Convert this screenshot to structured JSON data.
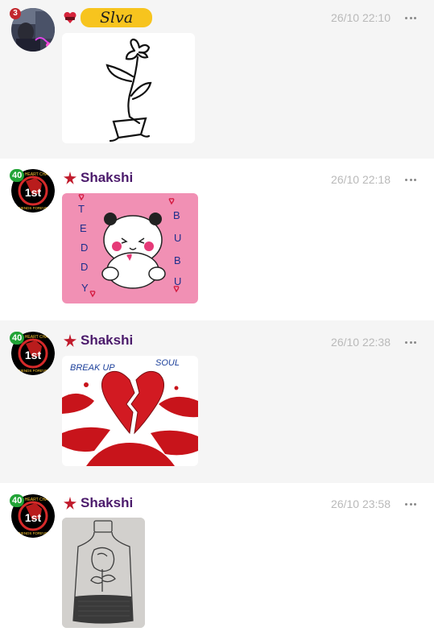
{
  "feed": {
    "posts": [
      {
        "author": "Slva",
        "level": "3",
        "timestamp": "26/10 22:10",
        "image": "flower-pot-drawing"
      },
      {
        "author": "Shakshi",
        "level": "40",
        "avatar_text_top": "TAH HEART CHAT",
        "avatar_text_mid": "1st",
        "avatar_text_bottom": "FRIENDS FOREVER",
        "timestamp": "26/10 22:18",
        "image": "teddy-bubu-drawing",
        "image_text_left": [
          "T",
          "E",
          "D",
          "D",
          "Y"
        ],
        "image_text_right": [
          "B",
          "U",
          "B",
          "U"
        ]
      },
      {
        "author": "Shakshi",
        "level": "40",
        "avatar_text_top": "TAH HEART CHAT",
        "avatar_text_mid": "1st",
        "avatar_text_bottom": "FRIENDS FOREVER",
        "timestamp": "26/10 22:38",
        "image": "broken-heart-drawing",
        "image_text_a": "BREAK UP",
        "image_text_b": "SOUL"
      },
      {
        "author": "Shakshi",
        "level": "40",
        "avatar_text_top": "TAH HEART CHAT",
        "avatar_text_mid": "1st",
        "avatar_text_bottom": "FRIENDS FOREVER",
        "timestamp": "26/10 23:58",
        "image": "bottle-sketch"
      }
    ]
  },
  "icons": {
    "more": "more-horizontal-icon",
    "heart_badge": "heart-badge-icon",
    "star_rank": "star-rank-icon"
  },
  "colors": {
    "name_pill": "#f7c41e",
    "name_purple": "#4b1a6b",
    "timestamp": "#b9b9b9",
    "level_green": "#21a336",
    "level_red": "#c2272d"
  }
}
